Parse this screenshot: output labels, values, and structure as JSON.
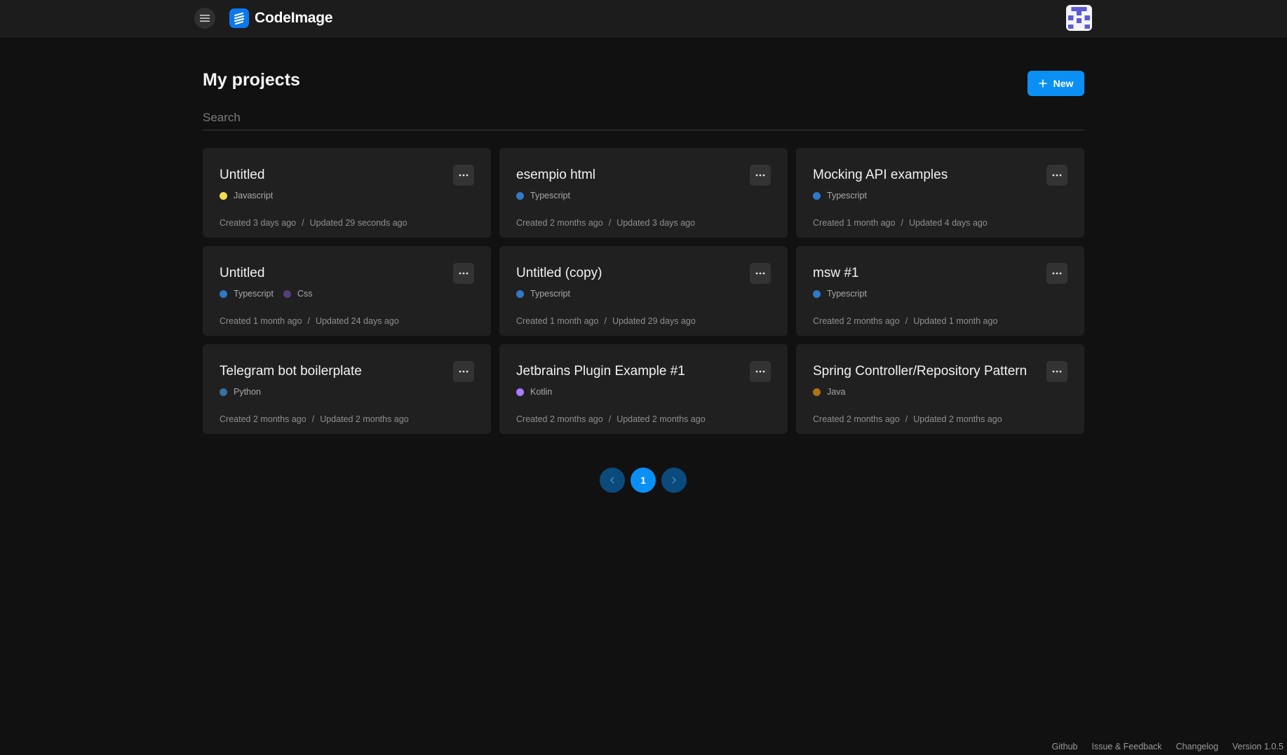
{
  "app": {
    "name": "CodeImage"
  },
  "page": {
    "title": "My projects",
    "new_button": "New",
    "search_placeholder": "Search"
  },
  "projects": [
    {
      "title": "Untitled",
      "langs": [
        {
          "name": "Javascript",
          "color": "#f5dc4d"
        }
      ],
      "created": "Created 3 days ago",
      "updated": "Updated 29 seconds ago"
    },
    {
      "title": "esempio html",
      "langs": [
        {
          "name": "Typescript",
          "color": "#3178c6"
        }
      ],
      "created": "Created 2 months ago",
      "updated": "Updated 3 days ago"
    },
    {
      "title": "Mocking API examples",
      "langs": [
        {
          "name": "Typescript",
          "color": "#3178c6"
        }
      ],
      "created": "Created 1 month ago",
      "updated": "Updated 4 days ago"
    },
    {
      "title": "Untitled",
      "langs": [
        {
          "name": "Typescript",
          "color": "#3178c6"
        },
        {
          "name": "Css",
          "color": "#563d7c"
        }
      ],
      "created": "Created 1 month ago",
      "updated": "Updated 24 days ago"
    },
    {
      "title": "Untitled (copy)",
      "langs": [
        {
          "name": "Typescript",
          "color": "#3178c6"
        }
      ],
      "created": "Created 1 month ago",
      "updated": "Updated 29 days ago"
    },
    {
      "title": "msw #1",
      "langs": [
        {
          "name": "Typescript",
          "color": "#3178c6"
        }
      ],
      "created": "Created 2 months ago",
      "updated": "Updated 1 month ago"
    },
    {
      "title": "Telegram bot boilerplate",
      "langs": [
        {
          "name": "Python",
          "color": "#3572a5"
        }
      ],
      "created": "Created 2 months ago",
      "updated": "Updated 2 months ago"
    },
    {
      "title": "Jetbrains Plugin Example #1",
      "langs": [
        {
          "name": "Kotlin",
          "color": "#a97bff"
        }
      ],
      "created": "Created 2 months ago",
      "updated": "Updated 2 months ago"
    },
    {
      "title": "Spring Controller/Repository Pattern",
      "langs": [
        {
          "name": "Java",
          "color": "#b07219"
        }
      ],
      "created": "Created 2 months ago",
      "updated": "Updated 2 months ago"
    }
  ],
  "pagination": {
    "current": "1",
    "prev_icon": "chevron-left-icon",
    "next_icon": "chevron-right-icon"
  },
  "footer": {
    "links": [
      "Github",
      "Issue & Feedback",
      "Changelog"
    ],
    "version": "Version 1.0.5"
  },
  "colors": {
    "accent": "#0a90f5",
    "background": "#111111",
    "card": "#202020",
    "topbar": "#1c1c1c"
  }
}
